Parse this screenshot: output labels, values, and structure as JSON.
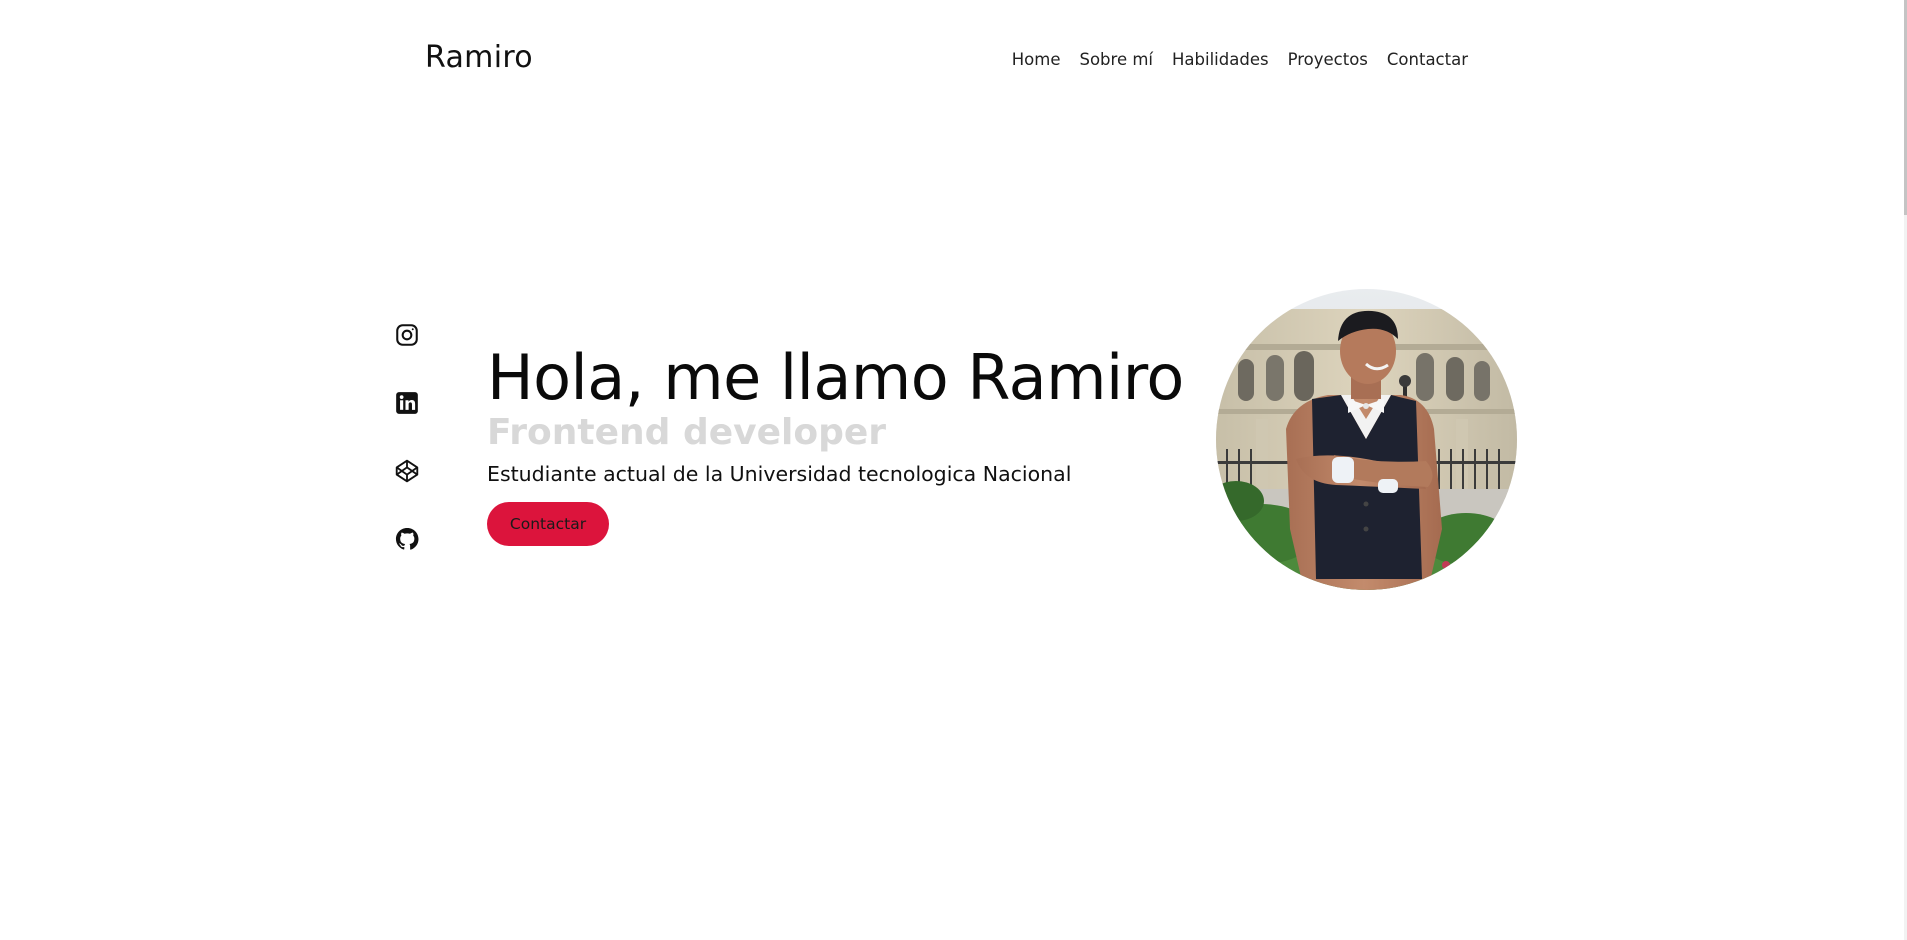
{
  "header": {
    "logo": "Ramiro",
    "nav": [
      {
        "label": "Home"
      },
      {
        "label": "Sobre mí"
      },
      {
        "label": "Habilidades"
      },
      {
        "label": "Proyectos"
      },
      {
        "label": "Contactar"
      }
    ]
  },
  "social": [
    {
      "icon": "instagram-icon"
    },
    {
      "icon": "linkedin-icon"
    },
    {
      "icon": "codepen-icon"
    },
    {
      "icon": "github-icon"
    }
  ],
  "hero": {
    "title": "Hola, me llamo Ramiro",
    "subtitle": "Frontend developer",
    "description": "Estudiante actual de la Universidad tecnologica Nacional",
    "button_label": "Contactar"
  },
  "colors": {
    "accent": "#dc143c",
    "subtitle": "#d8d8d8",
    "text": "#111111"
  }
}
